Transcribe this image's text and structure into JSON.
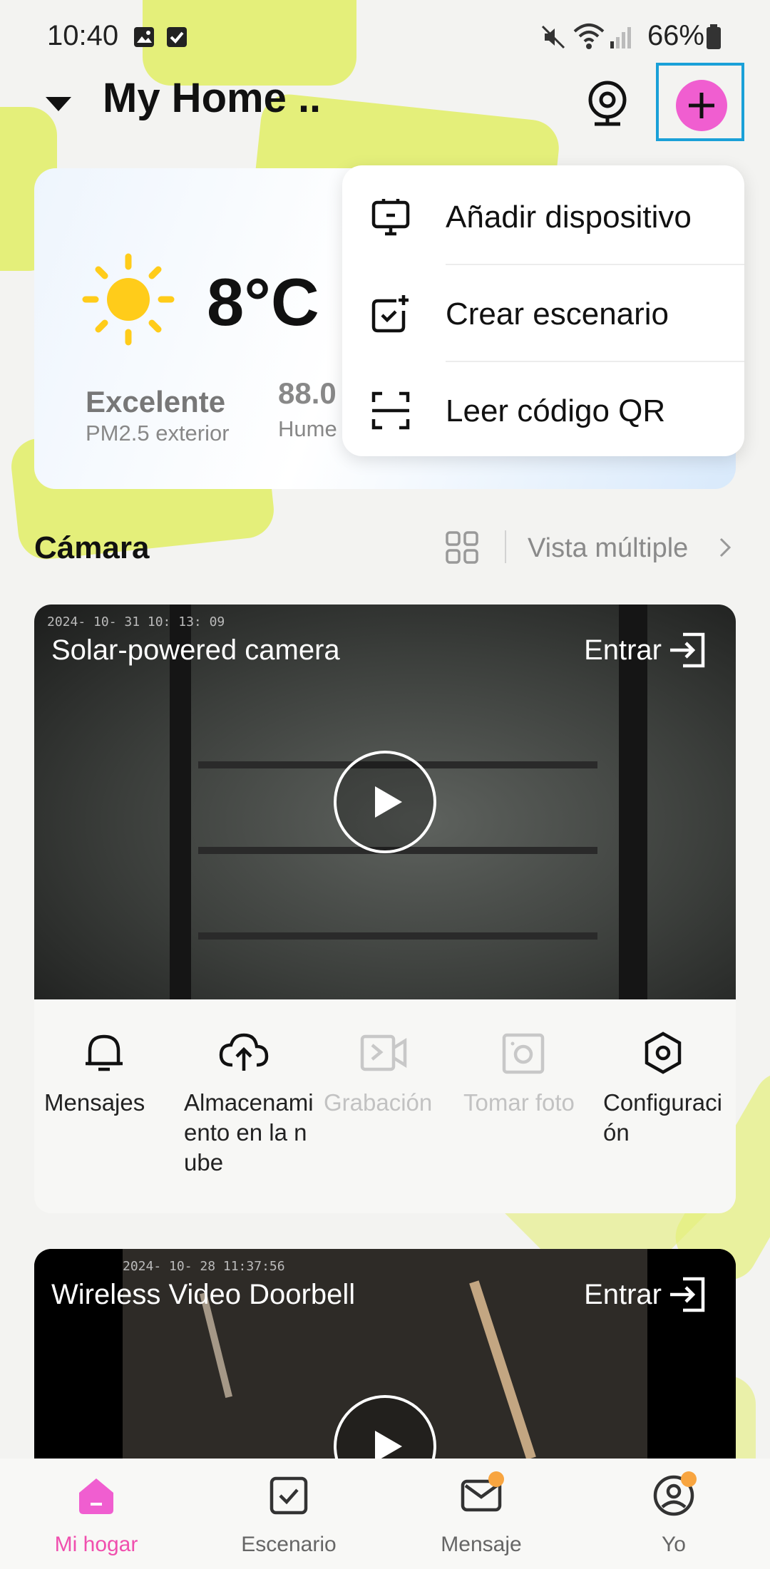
{
  "status_bar": {
    "time": "10:40",
    "battery": "66%"
  },
  "header": {
    "home_title": "My Home ..",
    "icons": [
      "dropdown-triangle-icon",
      "camera-icon",
      "plus-icon"
    ]
  },
  "weather": {
    "temperature": "8°C",
    "air_quality": "Excelente",
    "air_quality_label": "PM2.5 exterior",
    "humidity_value": "88.0",
    "humidity_label": "Hume"
  },
  "menu": {
    "items": [
      {
        "label": "Añadir dispositivo",
        "icon": "add-device-icon"
      },
      {
        "label": "Crear escenario",
        "icon": "create-scene-icon"
      },
      {
        "label": "Leer código QR",
        "icon": "qr-scan-icon"
      }
    ]
  },
  "camera_section": {
    "title": "Cámara",
    "multi_view": "Vista múltiple"
  },
  "cameras": [
    {
      "name": "Solar-powered camera",
      "timestamp": "2024- 10- 31 10: 13: 09",
      "enter": "Entrar",
      "actions": [
        {
          "label": "Mensajes",
          "enabled": true
        },
        {
          "label": "Almacenamiento en la nube",
          "enabled": true
        },
        {
          "label": "Grabación",
          "enabled": false
        },
        {
          "label": "Tomar foto",
          "enabled": false
        },
        {
          "label": "Configuración",
          "enabled": true
        }
      ]
    },
    {
      "name": "Wireless Video Doorbell",
      "timestamp": "2024- 10- 28 11:37:56",
      "enter": "Entrar"
    }
  ],
  "bottom_nav": {
    "items": [
      {
        "label": "Mi hogar",
        "active": true
      },
      {
        "label": "Escenario",
        "active": false
      },
      {
        "label": "Mensaje",
        "active": false
      },
      {
        "label": "Yo",
        "active": false
      }
    ]
  },
  "colors": {
    "accent_pink": "#f04fae",
    "highlight_blue": "#1aa0d8",
    "background_yellow": "#e4ef7a",
    "notification_dot": "#f8a540"
  }
}
